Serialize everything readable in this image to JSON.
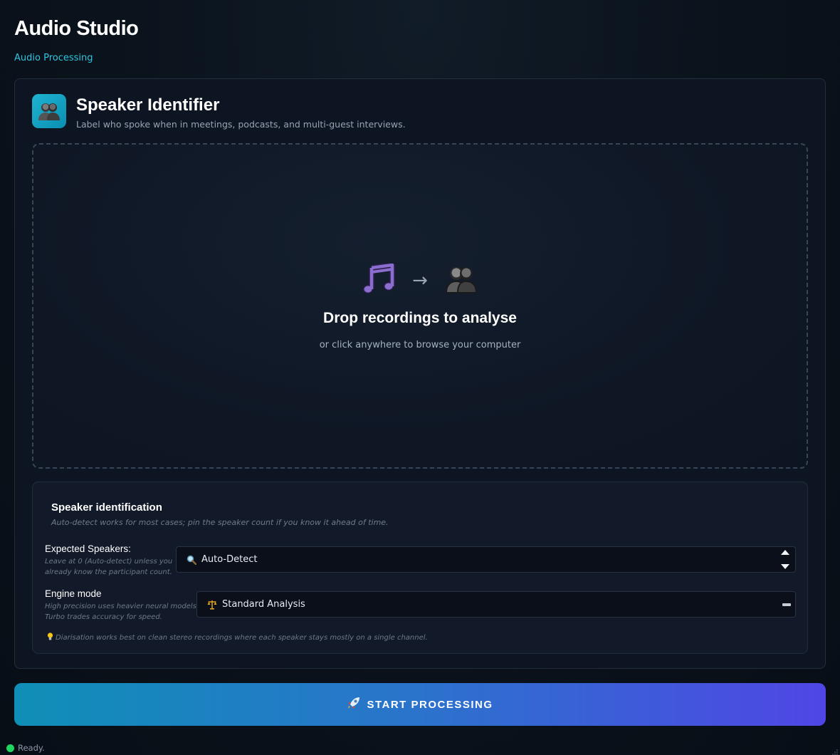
{
  "app": {
    "title": "Audio Studio",
    "subtitle": "Audio Processing"
  },
  "tool": {
    "icon": "two-people-icon",
    "title": "Speaker Identifier",
    "description": "Label who spoke when in meetings, podcasts, and multi-guest interviews."
  },
  "dropzone": {
    "icons": [
      "music-note-icon",
      "arrow-right-icon",
      "two-people-icon"
    ],
    "arrow": "→",
    "title": "Drop recordings to analyse",
    "subtitle": "or click anywhere to browse your computer"
  },
  "settings": {
    "title": "Speaker identification",
    "description": "Auto-detect works for most cases; pin the speaker count if you know it ahead of time.",
    "expected_speakers": {
      "label": "Expected Speakers:",
      "hint_line1": "Leave at 0 (Auto-detect) unless you",
      "hint_line2": "already know the participant count.",
      "value": "Auto-Detect",
      "icon": "magnifier-icon"
    },
    "engine_mode": {
      "label": "Engine mode",
      "hint_line1": "High precision uses heavier neural models;",
      "hint_line2": "Turbo trades accuracy for speed.",
      "value": "Standard Analysis",
      "icon": "balance-scale-icon"
    },
    "tip": "Diarisation works best on clean stereo recordings where each speaker stays mostly on a single channel.",
    "tip_icon": "lightbulb-icon"
  },
  "actions": {
    "start_label": "START PROCESSING",
    "start_icon": "rocket-icon"
  },
  "status": {
    "text": "Ready.",
    "indicator_color": "#1ed760"
  },
  "colors": {
    "accent": "#2fc6e0",
    "button_gradient_start": "#0f8fb7",
    "button_gradient_end": "#4f46e5"
  }
}
